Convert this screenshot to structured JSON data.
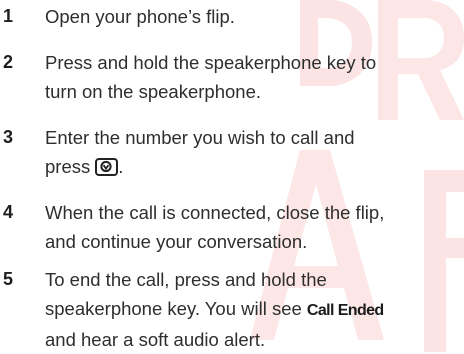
{
  "steps": [
    {
      "number": "1",
      "lines": [
        "Open your phone’s flip."
      ]
    },
    {
      "number": "2",
      "lines": [
        "Press and hold the speakerphone key to",
        "turn on the speakerphone."
      ]
    },
    {
      "number": "3",
      "lines": [
        "Enter the number you wish to call and",
        "press"
      ],
      "suffix": "."
    },
    {
      "number": "4",
      "lines": [
        "When the call is connected, close the flip,",
        "and continue your conversation."
      ]
    },
    {
      "number": "5",
      "lines": [
        "To end the call, press and hold the",
        "speakerphone key. You will see "
      ],
      "bold_term": "Call Ended",
      "last_line": "and hear a soft audio alert."
    }
  ],
  "icons": {
    "send_key": "send-key-icon"
  },
  "colors": {
    "text": "#2e2e2e",
    "watermark": "#ea3b3b"
  }
}
